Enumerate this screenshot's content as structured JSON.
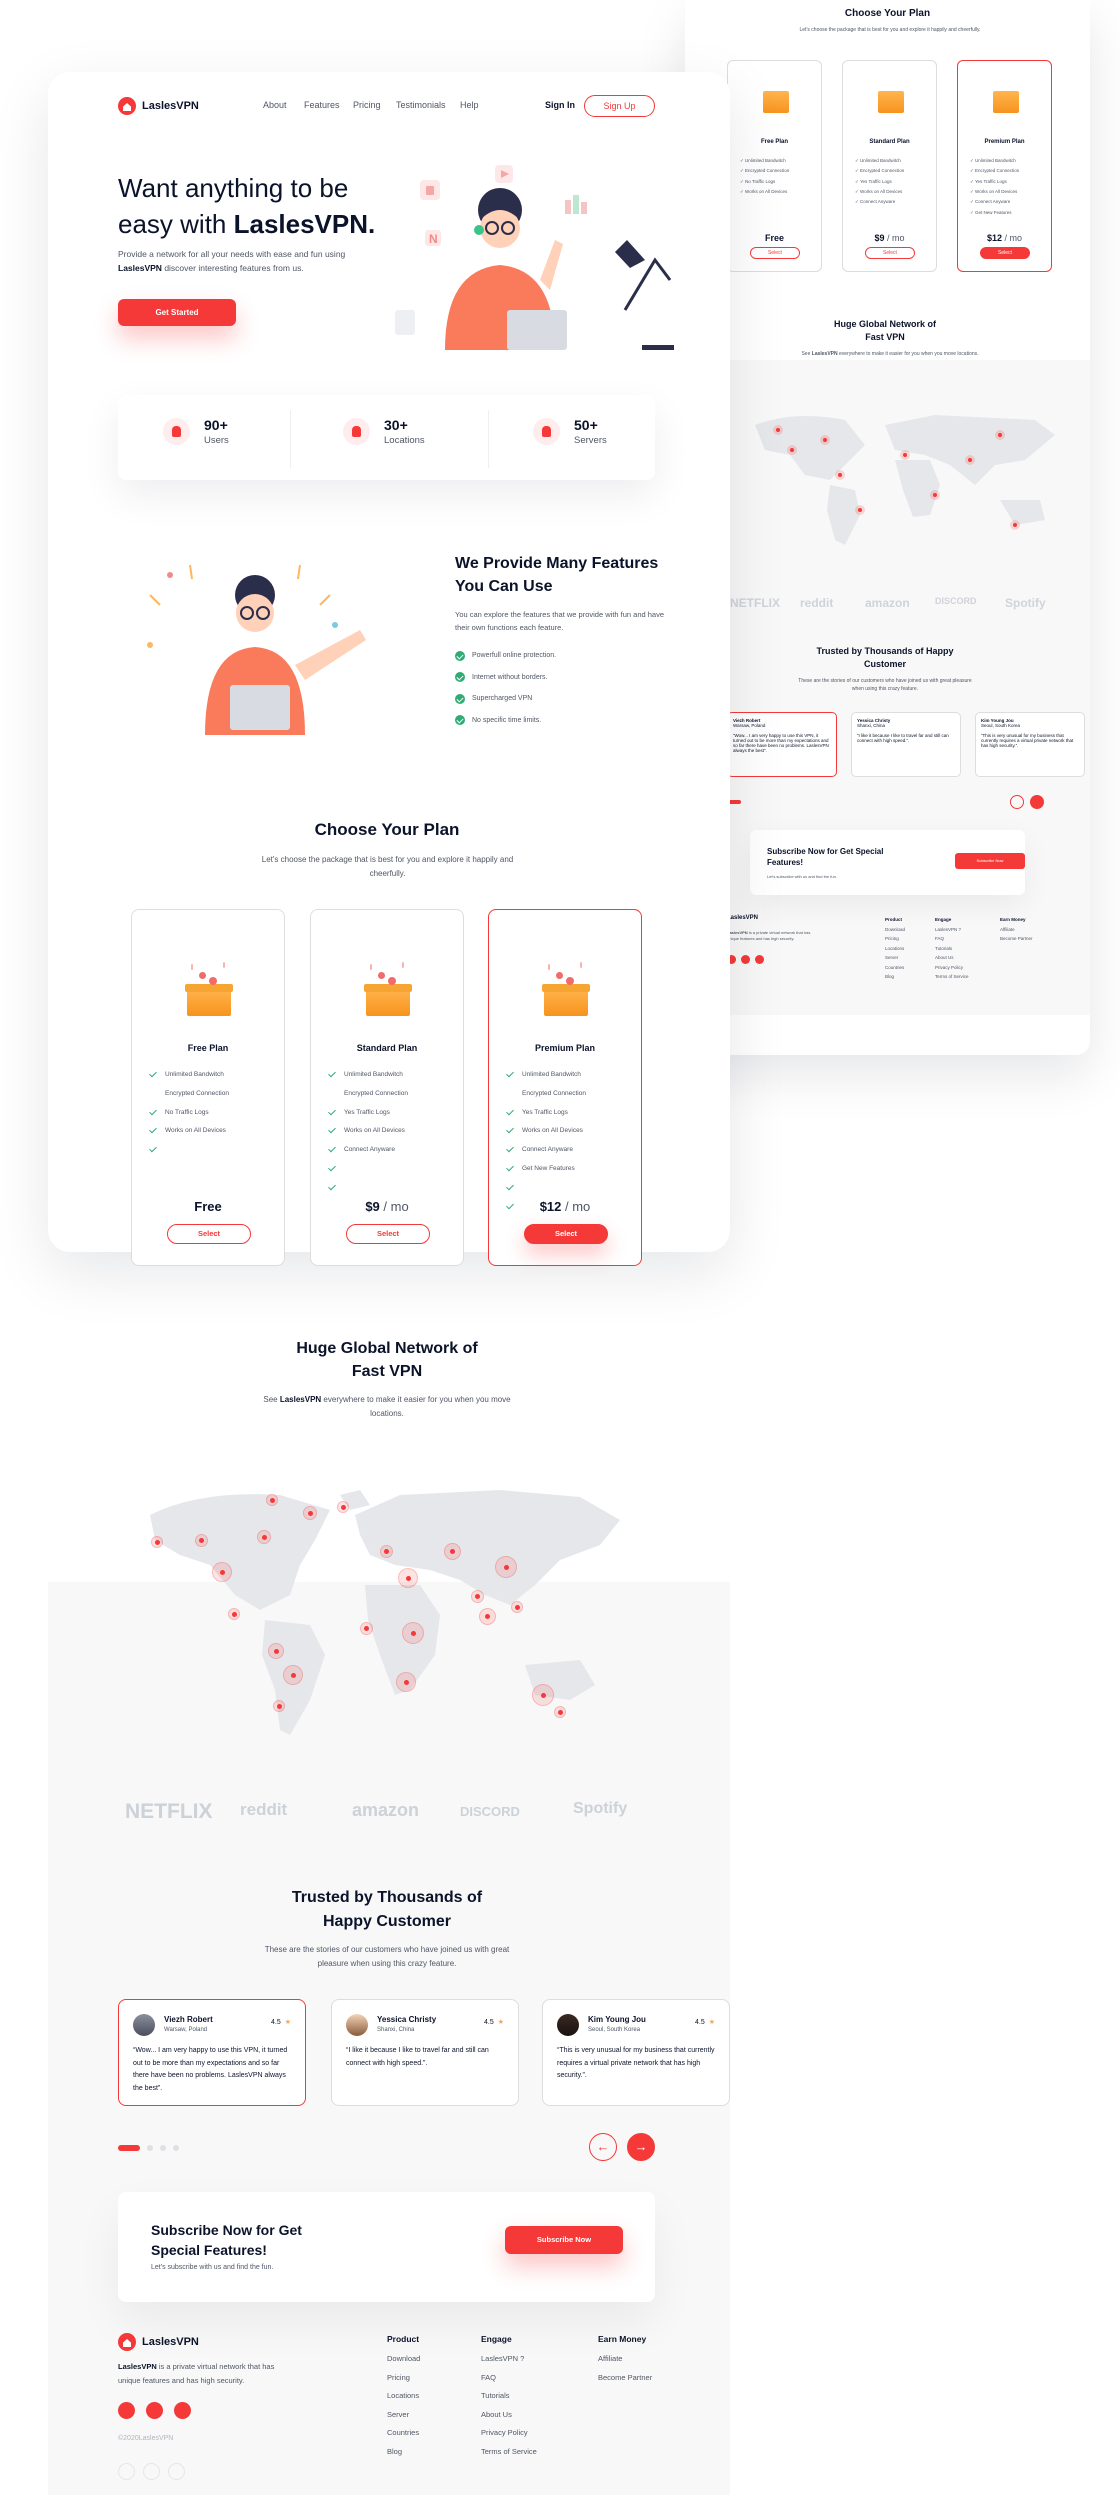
{
  "brand": {
    "name": "LaslesVPN",
    "footer_copy": "©2020LaslesVPN"
  },
  "nav": {
    "links": [
      "About",
      "Features",
      "Pricing",
      "Testimonials",
      "Help"
    ],
    "sign_in": "Sign In",
    "sign_up": "Sign Up"
  },
  "hero": {
    "title_part1": "Want anything to be easy with ",
    "title_bold": "LaslesVPN.",
    "desc_part1": "Provide a network for all your needs with ease and fun using ",
    "desc_bold": "LaslesVPN",
    "desc_part2": " discover interesting features from us.",
    "cta": "Get Started"
  },
  "stats": [
    {
      "number": "90+",
      "label": "Users",
      "icon": "user-icon"
    },
    {
      "number": "30+",
      "label": "Locations",
      "icon": "location-pin-icon"
    },
    {
      "number": "50+",
      "label": "Servers",
      "icon": "server-icon"
    }
  ],
  "features": {
    "title": "We Provide Many Features You Can Use",
    "desc": "You can explore the features that we provide with fun and have their own functions each feature.",
    "items": [
      "Powerfull online protection.",
      "Internet without borders.",
      "Supercharged VPN",
      "No specific time limits."
    ]
  },
  "plans": {
    "title": "Choose Your Plan",
    "desc": "Let's choose the package that is best for you and explore it happily and cheerfully.",
    "items": [
      {
        "name": "Free Plan",
        "price": "Free",
        "per": "",
        "button": "Select",
        "active": false,
        "features": [
          "Unlimited Bandwitch",
          "Encrypted Connection",
          "No Traffic Logs",
          "Works on All Devices",
          "",
          ""
        ]
      },
      {
        "name": "Standard Plan",
        "price": "$9",
        "per": " / mo",
        "button": "Select",
        "active": false,
        "features": [
          "Unlimited Bandwitch",
          "Encrypted Connection",
          "Yes Traffic Logs",
          "Works on All Devices",
          "Connect Anyware",
          "",
          ""
        ]
      },
      {
        "name": "Premium Plan",
        "price": "$12",
        "per": " / mo",
        "button": "Select",
        "active": true,
        "features": [
          "Unlimited Bandwitch",
          "Encrypted Connection",
          "Yes Traffic Logs",
          "Works on All Devices",
          "Connect Anyware",
          "Get New Features",
          "",
          ""
        ]
      }
    ]
  },
  "network": {
    "title": "Huge Global Network of Fast VPN",
    "desc_part1": "See ",
    "desc_bold": "LaslesVPN",
    "desc_part2": " everywhere to make it easier for you when you move locations."
  },
  "partners": [
    "NETFLIX",
    "reddit",
    "amazon",
    "DISCORD",
    "Spotify"
  ],
  "testimonials": {
    "title": "Trusted by Thousands of Happy Customer",
    "desc": "These are the stories of our customers who have joined us with great pleasure when using this crazy feature.",
    "items": [
      {
        "name": "Viezh Robert",
        "location": "Warsaw, Poland",
        "rating": "4.5",
        "text": "“Wow... I am very happy to use this VPN, it turned out to be more than my expectations and so far there have been no problems. LaslesVPN always the best”.",
        "active": true
      },
      {
        "name": "Yessica Christy",
        "location": "Shanxi, China",
        "rating": "4.5",
        "text": "“I like it because I like to travel far and still can connect with high speed.”.",
        "active": false
      },
      {
        "name": "Kim Young Jou",
        "location": "Seoul, South Korea",
        "rating": "4.5",
        "text": "“This is very unusual for my business that currently requires a virtual private network that has high security.”.",
        "active": false
      }
    ],
    "prev_icon": "←",
    "next_icon": "→"
  },
  "subscribe": {
    "title": "Subscribe Now for Get Special Features!",
    "desc": "Let's subscribe with us and find the fun.",
    "button": "Subscribe Now"
  },
  "footer": {
    "desc_bold": "LaslesVPN",
    "desc": " is a private virtual network that has unique features and has high security.",
    "columns": [
      {
        "title": "Product",
        "links": [
          "Download",
          "Pricing",
          "Locations",
          "Server",
          "Countries",
          "Blog"
        ]
      },
      {
        "title": "Engage",
        "links": [
          "LaslesVPN ?",
          "FAQ",
          "Tutorials",
          "About Us",
          "Privacy Policy",
          "Terms of Service"
        ]
      },
      {
        "title": "Earn Money",
        "links": [
          "Affiliate",
          "Become Partner"
        ]
      }
    ]
  },
  "colors": {
    "accent": "#F53838",
    "text": "#0B132A",
    "muted": "#4F5665",
    "check": "#2FAB73",
    "star": "#FEA250"
  }
}
